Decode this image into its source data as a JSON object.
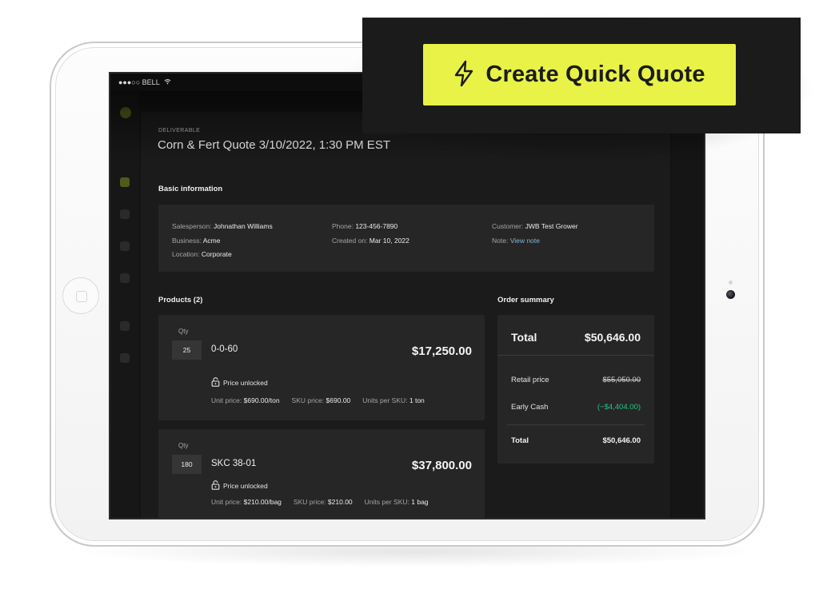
{
  "statusbar": {
    "carrier": "●●●○○ BELL"
  },
  "quote": {
    "eyebrow": "DELIVERABLE",
    "title": "Corn & Fert Quote 3/10/2022, 1:30 PM EST"
  },
  "basic_info": {
    "title": "Basic information",
    "salesperson_label": "Salesperson:",
    "salesperson": "Johnathan Williams",
    "business_label": "Business:",
    "business": "Acme",
    "location_label": "Location:",
    "location": "Corporate",
    "phone_label": "Phone:",
    "phone": "123-456-7890",
    "created_label": "Created on:",
    "created": "Mar 10, 2022",
    "customer_label": "Customer:",
    "customer": "JWB Test Grower",
    "note_label": "Note:",
    "note_link": "View note"
  },
  "products": {
    "title": "Products (2)",
    "qty_label": "Qty",
    "lock_text": "Price unlocked",
    "unit_price_label": "Unit price:",
    "sku_price_label": "SKU price:",
    "units_per_sku_label": "Units per SKU:",
    "items": [
      {
        "qty": "25",
        "name": "0-0-60",
        "price": "$17,250.00",
        "unit_price": "$690.00/ton",
        "sku_price": "$690.00",
        "units_per_sku": "1 ton"
      },
      {
        "qty": "180",
        "name": "SKC 38-01",
        "price": "$37,800.00",
        "unit_price": "$210.00/bag",
        "sku_price": "$210.00",
        "units_per_sku": "1 bag"
      }
    ]
  },
  "summary": {
    "title": "Order summary",
    "total_label": "Total",
    "total_value": "$50,646.00",
    "retail_label": "Retail price",
    "retail_value": "$55,050.00",
    "early_cash_label": "Early Cash",
    "early_cash_value": "(−$4,404.00)",
    "footer_total_label": "Total",
    "footer_total_value": "$50,646.00"
  },
  "cta": {
    "label": "Create Quick Quote"
  },
  "colors": {
    "accent": "#e8f247",
    "discount": "#28c486",
    "link": "#7fb6d6",
    "background": "#131313"
  }
}
